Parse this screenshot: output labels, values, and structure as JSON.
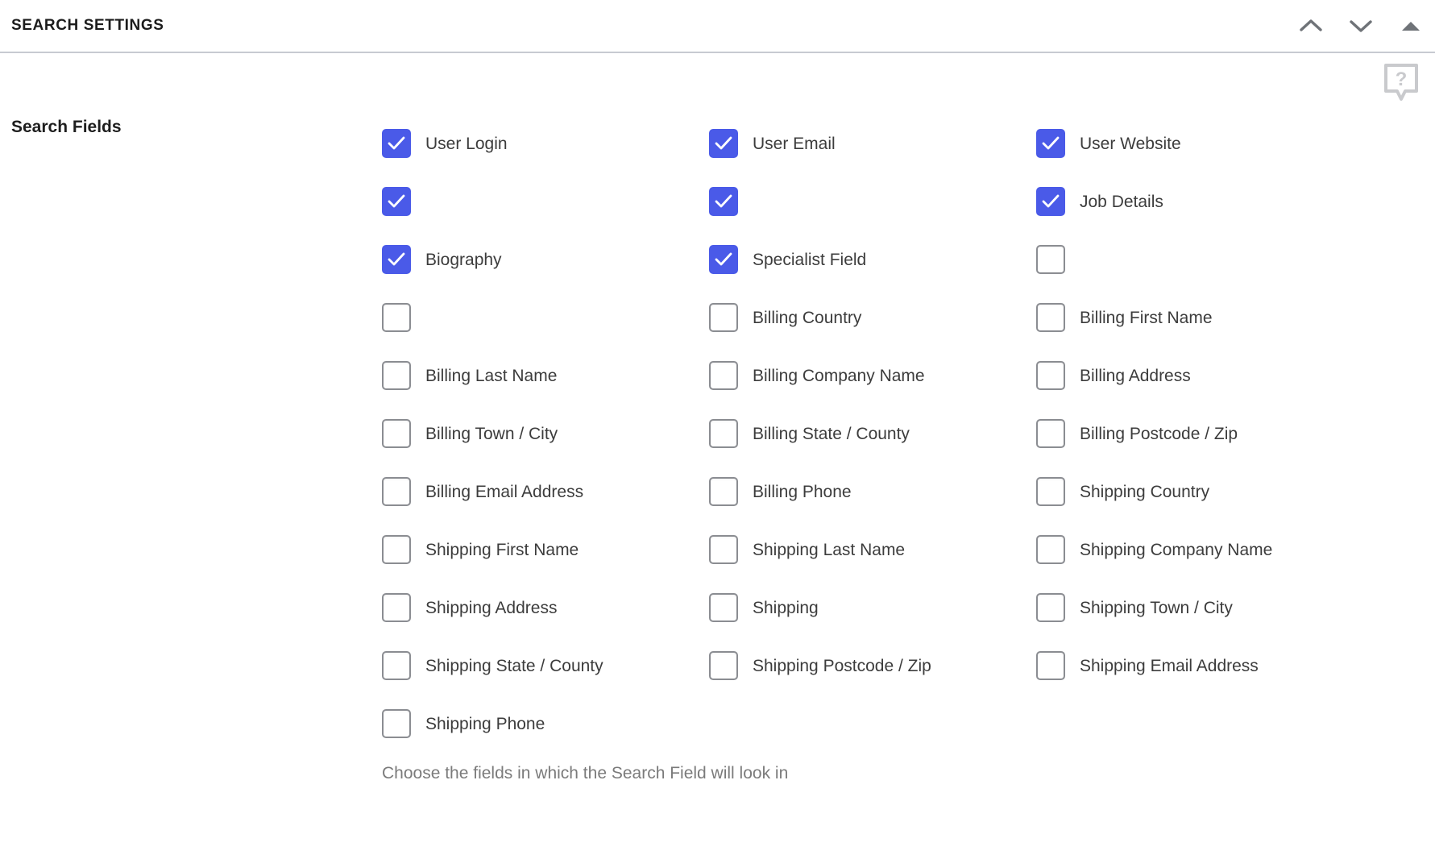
{
  "header": {
    "title": "SEARCH SETTINGS",
    "actions": [
      {
        "name": "chevron-up-icon",
        "label": "Move up"
      },
      {
        "name": "chevron-down-icon",
        "label": "Move down"
      },
      {
        "name": "triangle-up-icon",
        "label": "Collapse"
      }
    ]
  },
  "help": {
    "icon": "help-question-bubble-icon",
    "glyph": "?"
  },
  "colors": {
    "checkbox_checked": "#4a5ae8",
    "checkbox_border": "#8b8d92",
    "header_divider": "#c7cad1",
    "label_text": "#3c3c3c",
    "helper_text": "#7b7b7b",
    "icon_gray": "#6f7378",
    "help_icon_gray": "#c9cacd"
  },
  "setting": {
    "label": "Search Fields",
    "helper": "Choose the fields in which the Search Field will look in",
    "fields": [
      {
        "label": "User Login",
        "checked": true
      },
      {
        "label": "User Email",
        "checked": true
      },
      {
        "label": "User Website",
        "checked": true
      },
      {
        "label": "",
        "checked": true
      },
      {
        "label": "",
        "checked": true
      },
      {
        "label": "Job Details",
        "checked": true
      },
      {
        "label": "Biography",
        "checked": true
      },
      {
        "label": "Specialist Field",
        "checked": true
      },
      {
        "label": "",
        "checked": false
      },
      {
        "label": "",
        "checked": false
      },
      {
        "label": "Billing Country",
        "checked": false
      },
      {
        "label": "Billing First Name",
        "checked": false
      },
      {
        "label": "Billing Last Name",
        "checked": false
      },
      {
        "label": "Billing Company Name",
        "checked": false
      },
      {
        "label": "Billing Address",
        "checked": false
      },
      {
        "label": "Billing Town / City",
        "checked": false
      },
      {
        "label": "Billing State / County",
        "checked": false
      },
      {
        "label": "Billing Postcode / Zip",
        "checked": false
      },
      {
        "label": "Billing Email Address",
        "checked": false
      },
      {
        "label": "Billing Phone",
        "checked": false
      },
      {
        "label": "Shipping Country",
        "checked": false
      },
      {
        "label": "Shipping First Name",
        "checked": false
      },
      {
        "label": "Shipping Last Name",
        "checked": false
      },
      {
        "label": "Shipping Company Name",
        "checked": false
      },
      {
        "label": "Shipping Address",
        "checked": false
      },
      {
        "label": "Shipping",
        "checked": false
      },
      {
        "label": "Shipping Town / City",
        "checked": false
      },
      {
        "label": "Shipping State / County",
        "checked": false
      },
      {
        "label": "Shipping Postcode / Zip",
        "checked": false
      },
      {
        "label": "Shipping Email Address",
        "checked": false
      },
      {
        "label": "Shipping Phone",
        "checked": false
      }
    ]
  }
}
